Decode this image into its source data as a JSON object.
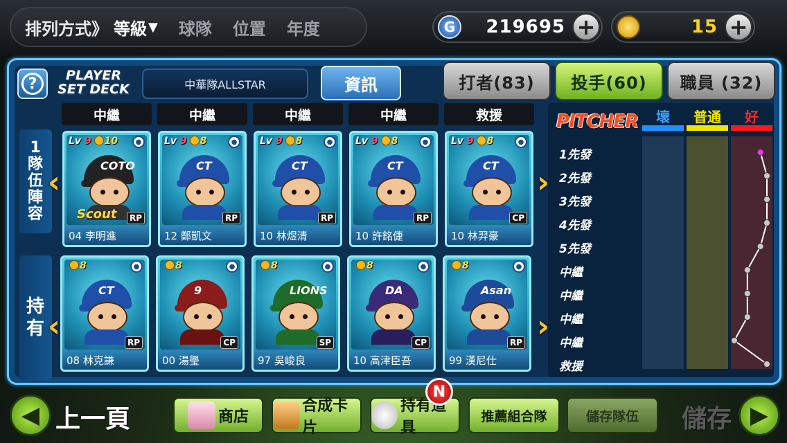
{
  "sort": {
    "label": "排列方式》",
    "options": [
      "等級",
      "球隊",
      "位置",
      "年度"
    ],
    "arrow": "▼"
  },
  "currency": {
    "g_icon": "G",
    "g_value": "219695",
    "coin_value": "15"
  },
  "header": {
    "logo_line1": "PLAYER",
    "logo_line2": "SET DECK",
    "deck_name": "中華隊ALLSTAR",
    "info_button": "資訊"
  },
  "tabs": [
    {
      "label": "打者(83)",
      "active": false
    },
    {
      "label": "投手(60)",
      "active": true
    },
    {
      "label": "職員 (32)",
      "active": false
    }
  ],
  "side": {
    "team_label": "1隊伍陣容",
    "own_label": "持有"
  },
  "positions": [
    "中繼",
    "中繼",
    "中繼",
    "中繼",
    "救援"
  ],
  "lineup_cards": [
    {
      "lv": "9",
      "cost": "10",
      "role": "RP",
      "name": "04 李明進",
      "cap": "#222",
      "body": "#333",
      "logo": "COTO",
      "scout": "Scout",
      "num": "#1"
    },
    {
      "lv": "9",
      "cost": "8",
      "role": "RP",
      "name": "12 鄭凱文",
      "cap": "#1f4fa8",
      "body": "#1f4fa8",
      "logo": "CT",
      "scout": "",
      "num": "#1"
    },
    {
      "lv": "9",
      "cost": "8",
      "role": "RP",
      "name": "10 林煜清",
      "cap": "#1f4fa8",
      "body": "#1f4fa8",
      "logo": "CT",
      "scout": "",
      "num": "#1"
    },
    {
      "lv": "9",
      "cost": "8",
      "role": "RP",
      "name": "10 許銘倢",
      "cap": "#1f4fa8",
      "body": "#1f4fa8",
      "logo": "CT",
      "scout": "",
      "num": "#1"
    },
    {
      "lv": "9",
      "cost": "8",
      "role": "CP",
      "name": "10 林羿豪",
      "cap": "#1f4fa8",
      "body": "#1f4fa8",
      "logo": "CT",
      "scout": "",
      "num": "#1"
    }
  ],
  "owned_cards": [
    {
      "cost": "8",
      "role": "RP",
      "name": "08 林克謙",
      "cap": "#1f4fa8",
      "body": "#1f4fa8",
      "logo": "CT"
    },
    {
      "cost": "8",
      "role": "CP",
      "name": "00 湯璺",
      "cap": "#8a1c1c",
      "body": "#6a1212",
      "logo": "9"
    },
    {
      "cost": "8",
      "role": "SP",
      "name": "97 吳峻良",
      "cap": "#1f6b2a",
      "body": "#1f6b2a",
      "logo": "LIONS"
    },
    {
      "cost": "8",
      "role": "CP",
      "name": "10 高津臣吾",
      "cap": "#3a2a7a",
      "body": "#2a1d5c",
      "logo": "DA"
    },
    {
      "cost": "8",
      "role": "RP",
      "name": "99 漢尼仕",
      "cap": "#1e4a9a",
      "body": "#1e4a9a",
      "logo": "Asan"
    }
  ],
  "chart": {
    "title": "PITCHER",
    "legend": [
      {
        "label": "壞",
        "color": "#1e90ff"
      },
      {
        "label": "普通",
        "color": "#f2e600"
      },
      {
        "label": "好",
        "color": "#ff1a1a"
      }
    ],
    "rows": [
      "1先發",
      "2先發",
      "3先發",
      "4先發",
      "5先發",
      "中繼",
      "中繼",
      "中繼",
      "中繼",
      "救援"
    ],
    "levels": [
      0.95,
      1.0,
      1.0,
      1.0,
      0.95,
      0.85,
      0.85,
      0.85,
      0.75,
      1.0
    ]
  },
  "bottom": {
    "prev_label": "上一頁",
    "shop_label": "商店",
    "synth_label": "合成卡片",
    "items_label": "持有道具",
    "items_badge": "N",
    "recommend_label": "推薦組合隊",
    "save_team_label": "儲存隊伍",
    "save_label": "儲存"
  }
}
